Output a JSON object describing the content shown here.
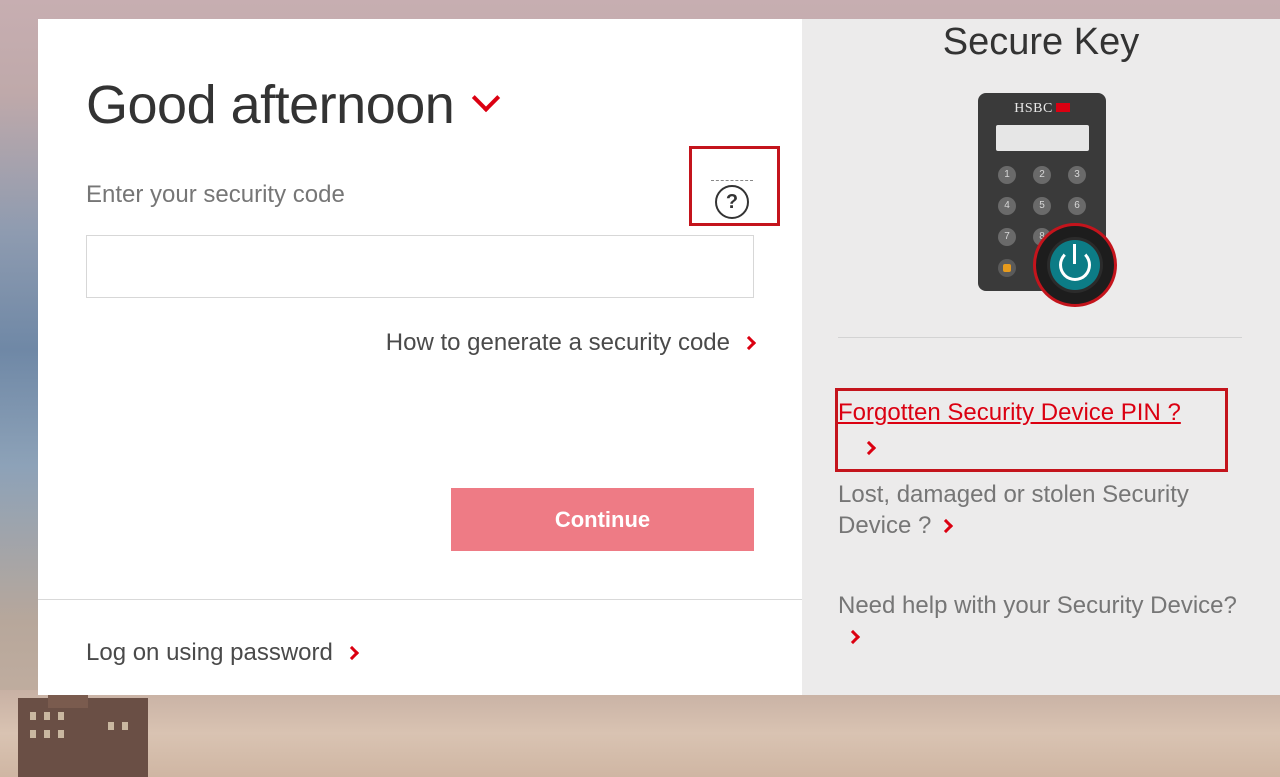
{
  "login": {
    "greeting": "Good afternoon",
    "security_code_label": "Enter your security code",
    "security_code_value": "",
    "help_icon": "question-mark-icon",
    "how_to_generate_link": "How to generate a security code",
    "continue_button": "Continue",
    "logon_password_link": "Log on using password"
  },
  "secure_key": {
    "title": "Secure Key",
    "device_brand": "HSBC",
    "keypad": [
      "1",
      "2",
      "3",
      "4",
      "5",
      "6",
      "7",
      "8"
    ],
    "forgotten_pin_link": "Forgotten Security Device PIN ?",
    "lost_device_link": "Lost, damaged or stolen Security Device ?",
    "need_help_link": "Need help with your Security Device?"
  },
  "colors": {
    "brand_red": "#db0011",
    "button_disabled": "#ee7b85",
    "highlight_box": "#c4141c"
  }
}
